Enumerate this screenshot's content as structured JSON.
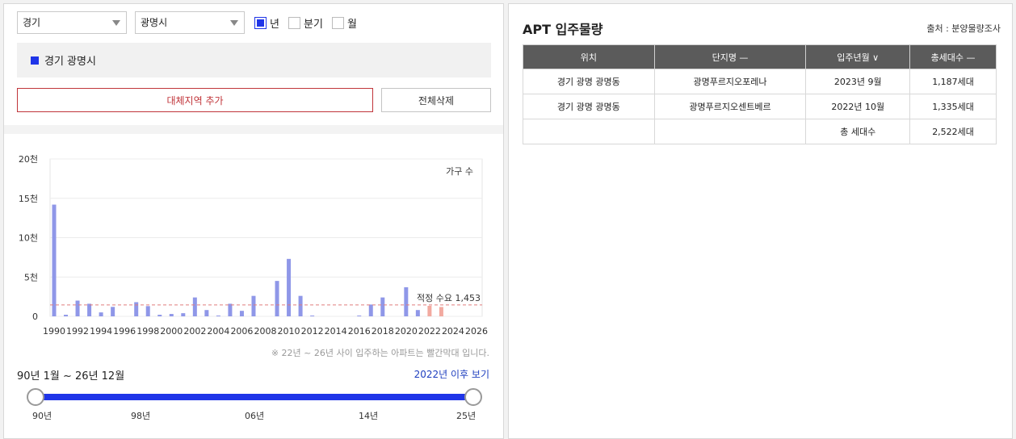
{
  "filters": {
    "province": "경기",
    "city": "광명시",
    "period_options": [
      {
        "label": "년",
        "checked": true
      },
      {
        "label": "분기",
        "checked": false
      },
      {
        "label": "월",
        "checked": false
      }
    ]
  },
  "selected_region": "경기 광명시",
  "buttons": {
    "add_alt_region": "대체지역 추가",
    "delete_all": "전체삭제"
  },
  "chart_note": "※ 22년 ~ 26년 사이 입주하는 아파트는 빨간막대 입니다.",
  "range": {
    "label": "90년 1월 ~ 26년 12월",
    "link": "2022년 이후 보기",
    "ticks": [
      "90년",
      "98년",
      "06년",
      "14년",
      "25년"
    ]
  },
  "chart_data": {
    "type": "bar",
    "legend": "가구 수",
    "y_ticks": [
      "20천",
      "15천",
      "10천",
      "5천",
      "0"
    ],
    "ylim": [
      0,
      20000
    ],
    "x_tick_labels": [
      "1990",
      "1992",
      "1994",
      "1996",
      "1998",
      "2000",
      "2002",
      "2004",
      "2006",
      "2008",
      "2010",
      "2012",
      "2014",
      "2016",
      "2018",
      "2020",
      "2022",
      "2024",
      "2026"
    ],
    "years": [
      1990,
      1991,
      1992,
      1993,
      1994,
      1995,
      1996,
      1997,
      1998,
      1999,
      2000,
      2001,
      2002,
      2003,
      2004,
      2005,
      2006,
      2007,
      2008,
      2009,
      2010,
      2011,
      2012,
      2013,
      2014,
      2015,
      2016,
      2017,
      2018,
      2019,
      2020,
      2021,
      2022,
      2023,
      2024,
      2025,
      2026
    ],
    "values": [
      14200,
      200,
      2000,
      1600,
      500,
      1200,
      0,
      1800,
      1300,
      200,
      300,
      400,
      2400,
      800,
      100,
      1600,
      700,
      2600,
      0,
      4500,
      7300,
      2600,
      100,
      0,
      0,
      0,
      100,
      1500,
      2400,
      0,
      3700,
      800,
      1335,
      1187,
      0,
      0,
      0
    ],
    "highlight_from_year": 2022,
    "colors": {
      "normal": "#8f97e8",
      "highlight": "#f2aaa0",
      "demand_line": "#e07c7c"
    },
    "reference_line": {
      "label": "적정 수요 1,453",
      "value": 1453
    }
  },
  "right": {
    "title": "APT 입주물량",
    "source": "출처 : 분양물량조사",
    "table": {
      "headers": [
        "위치",
        "단지명 —",
        "입주년월 ∨",
        "총세대수 —"
      ],
      "rows": [
        [
          "경기 광명 광명동",
          "광명푸르지오포레나",
          "2023년 9월",
          "1,187세대"
        ],
        [
          "경기 광명 광명동",
          "광명푸르지오센트베르",
          "2022년 10월",
          "1,335세대"
        ],
        [
          "",
          "",
          "총 세대수",
          "2,522세대"
        ]
      ]
    }
  },
  "colors": {
    "accent": "#1f35e8",
    "danger": "#c0353a",
    "header_bg": "#5b5b5b"
  }
}
